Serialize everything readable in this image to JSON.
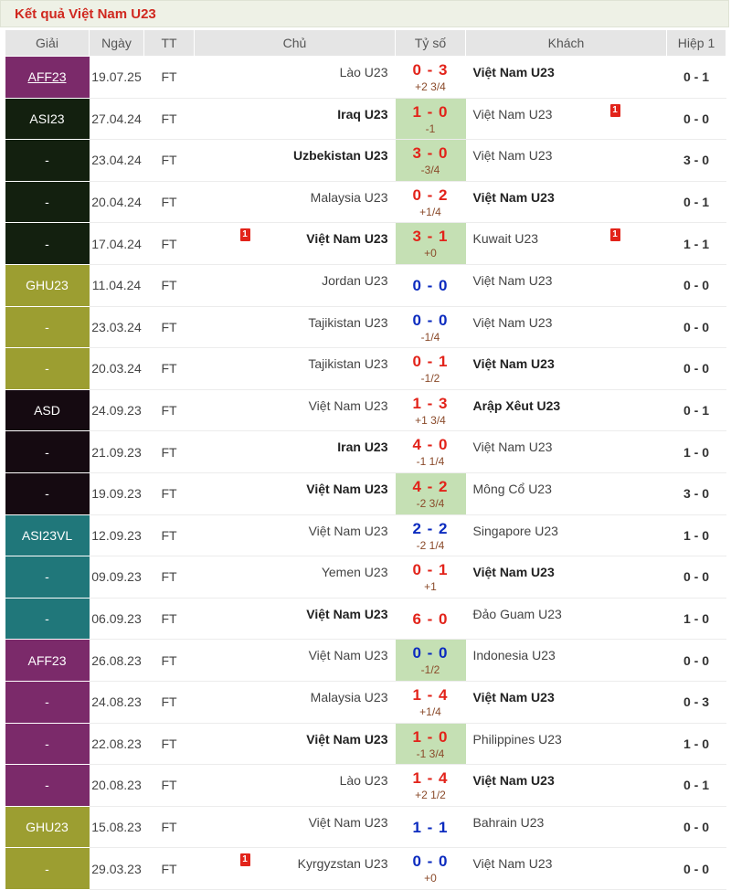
{
  "title": "Kết quả Việt Nam U23",
  "headers": {
    "league": "Giải",
    "date": "Ngày",
    "status": "TT",
    "home": "Chủ",
    "score": "Tỷ số",
    "away": "Khách",
    "ht": "Hiệp 1"
  },
  "colors": {
    "aff": "#7b2a6a",
    "asi": "#13200f",
    "ghu": "#9c9e31",
    "asd": "#150a11",
    "asivl": "#20777a"
  },
  "matches": [
    {
      "league": "AFF23",
      "lc": "aff",
      "link": true,
      "date": "19.07.25",
      "status": "FT",
      "home": "Lào U23",
      "hb": false,
      "score": "0 - 3",
      "sc": "red",
      "hc": "+2 3/4",
      "away": "Việt Nam U23",
      "ab": true,
      "ht": "0 - 1",
      "win": false,
      "hcard": "",
      "acard": ""
    },
    {
      "league": "ASI23",
      "lc": "asi",
      "link": false,
      "date": "27.04.24",
      "status": "FT",
      "home": "Iraq U23",
      "hb": true,
      "score": "1 - 0",
      "sc": "red",
      "hc": "-1",
      "away": "Việt Nam U23",
      "ab": false,
      "ht": "0 - 0",
      "win": true,
      "hcard": "",
      "acard": "1"
    },
    {
      "league": "-",
      "lc": "asi",
      "link": false,
      "date": "23.04.24",
      "status": "FT",
      "home": "Uzbekistan U23",
      "hb": true,
      "score": "3 - 0",
      "sc": "red",
      "hc": "-3/4",
      "away": "Việt Nam U23",
      "ab": false,
      "ht": "3 - 0",
      "win": true,
      "hcard": "",
      "acard": ""
    },
    {
      "league": "-",
      "lc": "asi",
      "link": false,
      "date": "20.04.24",
      "status": "FT",
      "home": "Malaysia U23",
      "hb": false,
      "score": "0 - 2",
      "sc": "red",
      "hc": "+1/4",
      "away": "Việt Nam U23",
      "ab": true,
      "ht": "0 - 1",
      "win": false,
      "hcard": "",
      "acard": ""
    },
    {
      "league": "-",
      "lc": "asi",
      "link": false,
      "date": "17.04.24",
      "status": "FT",
      "home": "Việt Nam U23",
      "hb": true,
      "score": "3 - 1",
      "sc": "red",
      "hc": "+0",
      "away": "Kuwait U23",
      "ab": false,
      "ht": "1 - 1",
      "win": true,
      "hcard": "1",
      "acard": "1"
    },
    {
      "league": "GHU23",
      "lc": "ghu",
      "link": false,
      "date": "11.04.24",
      "status": "FT",
      "home": "Jordan U23",
      "hb": false,
      "score": "0 - 0",
      "sc": "blue",
      "hc": "",
      "away": "Việt Nam U23",
      "ab": false,
      "ht": "0 - 0",
      "win": false,
      "hcard": "",
      "acard": ""
    },
    {
      "league": "-",
      "lc": "ghu",
      "link": false,
      "date": "23.03.24",
      "status": "FT",
      "home": "Tajikistan U23",
      "hb": false,
      "score": "0 - 0",
      "sc": "blue",
      "hc": "-1/4",
      "away": "Việt Nam U23",
      "ab": false,
      "ht": "0 - 0",
      "win": false,
      "hcard": "",
      "acard": ""
    },
    {
      "league": "-",
      "lc": "ghu",
      "link": false,
      "date": "20.03.24",
      "status": "FT",
      "home": "Tajikistan U23",
      "hb": false,
      "score": "0 - 1",
      "sc": "red",
      "hc": "-1/2",
      "away": "Việt Nam U23",
      "ab": true,
      "ht": "0 - 0",
      "win": false,
      "hcard": "",
      "acard": ""
    },
    {
      "league": "ASD",
      "lc": "asd",
      "link": false,
      "date": "24.09.23",
      "status": "FT",
      "home": "Việt Nam U23",
      "hb": false,
      "score": "1 - 3",
      "sc": "red",
      "hc": "+1 3/4",
      "away": "Arập Xêut U23",
      "ab": true,
      "ht": "0 - 1",
      "win": false,
      "hcard": "",
      "acard": ""
    },
    {
      "league": "-",
      "lc": "asd",
      "link": false,
      "date": "21.09.23",
      "status": "FT",
      "home": "Iran U23",
      "hb": true,
      "score": "4 - 0",
      "sc": "red",
      "hc": "-1 1/4",
      "away": "Việt Nam U23",
      "ab": false,
      "ht": "1 - 0",
      "win": false,
      "hcard": "",
      "acard": ""
    },
    {
      "league": "-",
      "lc": "asd",
      "link": false,
      "date": "19.09.23",
      "status": "FT",
      "home": "Việt Nam U23",
      "hb": true,
      "score": "4 - 2",
      "sc": "red",
      "hc": "-2 3/4",
      "away": "Mông Cổ U23",
      "ab": false,
      "ht": "3 - 0",
      "win": true,
      "hcard": "",
      "acard": ""
    },
    {
      "league": "ASI23VL",
      "lc": "asivl",
      "link": false,
      "date": "12.09.23",
      "status": "FT",
      "home": "Việt Nam U23",
      "hb": false,
      "score": "2 - 2",
      "sc": "blue",
      "hc": "-2 1/4",
      "away": "Singapore U23",
      "ab": false,
      "ht": "1 - 0",
      "win": false,
      "hcard": "",
      "acard": ""
    },
    {
      "league": "-",
      "lc": "asivl",
      "link": false,
      "date": "09.09.23",
      "status": "FT",
      "home": "Yemen U23",
      "hb": false,
      "score": "0 - 1",
      "sc": "red",
      "hc": "+1",
      "away": "Việt Nam U23",
      "ab": true,
      "ht": "0 - 0",
      "win": false,
      "hcard": "",
      "acard": ""
    },
    {
      "league": "-",
      "lc": "asivl",
      "link": false,
      "date": "06.09.23",
      "status": "FT",
      "home": "Việt Nam U23",
      "hb": true,
      "score": "6 - 0",
      "sc": "red",
      "hc": "",
      "away": "Đảo Guam U23",
      "ab": false,
      "ht": "1 - 0",
      "win": false,
      "hcard": "",
      "acard": ""
    },
    {
      "league": "AFF23",
      "lc": "aff",
      "link": false,
      "date": "26.08.23",
      "status": "FT",
      "home": "Việt Nam U23",
      "hb": false,
      "score": "0 - 0",
      "sc": "blue",
      "hc": "-1/2",
      "away": "Indonesia U23",
      "ab": false,
      "ht": "0 - 0",
      "win": true,
      "hcard": "",
      "acard": ""
    },
    {
      "league": "-",
      "lc": "aff",
      "link": false,
      "date": "24.08.23",
      "status": "FT",
      "home": "Malaysia U23",
      "hb": false,
      "score": "1 - 4",
      "sc": "red",
      "hc": "+1/4",
      "away": "Việt Nam U23",
      "ab": true,
      "ht": "0 - 3",
      "win": false,
      "hcard": "",
      "acard": ""
    },
    {
      "league": "-",
      "lc": "aff",
      "link": false,
      "date": "22.08.23",
      "status": "FT",
      "home": "Việt Nam U23",
      "hb": true,
      "score": "1 - 0",
      "sc": "red",
      "hc": "-1 3/4",
      "away": "Philippines U23",
      "ab": false,
      "ht": "1 - 0",
      "win": true,
      "hcard": "",
      "acard": ""
    },
    {
      "league": "-",
      "lc": "aff",
      "link": false,
      "date": "20.08.23",
      "status": "FT",
      "home": "Lào U23",
      "hb": false,
      "score": "1 - 4",
      "sc": "red",
      "hc": "+2 1/2",
      "away": "Việt Nam U23",
      "ab": true,
      "ht": "0 - 1",
      "win": false,
      "hcard": "",
      "acard": ""
    },
    {
      "league": "GHU23",
      "lc": "ghu",
      "link": false,
      "date": "15.08.23",
      "status": "FT",
      "home": "Việt Nam U23",
      "hb": false,
      "score": "1 - 1",
      "sc": "blue",
      "hc": "",
      "away": "Bahrain U23",
      "ab": false,
      "ht": "0 - 0",
      "win": false,
      "hcard": "",
      "acard": ""
    },
    {
      "league": "-",
      "lc": "ghu",
      "link": false,
      "date": "29.03.23",
      "status": "FT",
      "home": "Kyrgyzstan U23",
      "hb": false,
      "score": "0 - 0",
      "sc": "blue",
      "hc": "+0",
      "away": "Việt Nam U23",
      "ab": false,
      "ht": "0 - 0",
      "win": false,
      "hcard": "1",
      "acard": ""
    }
  ]
}
